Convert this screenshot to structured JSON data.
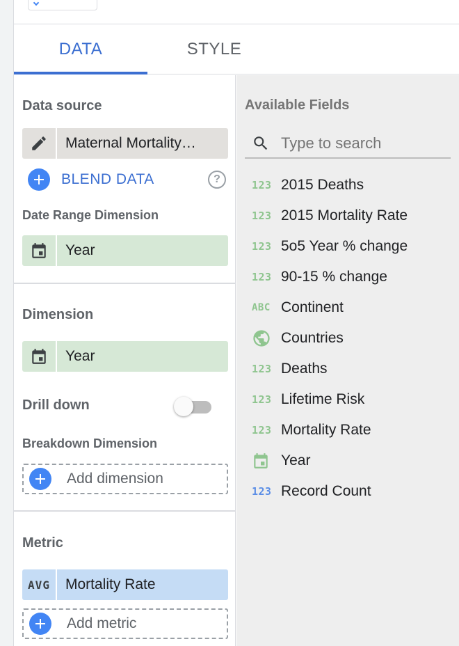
{
  "tabs": {
    "data_label": "DATA",
    "style_label": "STYLE"
  },
  "data_source": {
    "section_label": "Data source",
    "name": "Maternal Mortality…",
    "edit_icon": "pencil-icon",
    "blend_label": "BLEND DATA",
    "help_icon": "help-icon"
  },
  "date_range": {
    "section_label": "Date Range Dimension",
    "field": "Year",
    "icon": "calendar-icon"
  },
  "dimension": {
    "section_label": "Dimension",
    "field": "Year",
    "icon": "calendar-icon",
    "drill_down_label": "Drill down",
    "drill_down_enabled": false,
    "breakdown_label": "Breakdown Dimension",
    "add_dimension_label": "Add dimension"
  },
  "metric": {
    "section_label": "Metric",
    "aggregation": "AVG",
    "field": "Mortality Rate",
    "add_metric_label": "Add metric"
  },
  "available_fields": {
    "title": "Available Fields",
    "search_placeholder": "Type to search",
    "items": [
      {
        "label": "2015 Deaths",
        "type": "number",
        "icon_text": "123"
      },
      {
        "label": "2015 Mortality Rate",
        "type": "number",
        "icon_text": "123"
      },
      {
        "label": "5o5 Year % change",
        "type": "number",
        "icon_text": "123"
      },
      {
        "label": "90-15 % change",
        "type": "number",
        "icon_text": "123"
      },
      {
        "label": "Continent",
        "type": "text",
        "icon_text": "ABC"
      },
      {
        "label": "Countries",
        "type": "geo",
        "icon_text": ""
      },
      {
        "label": "Deaths",
        "type": "number",
        "icon_text": "123"
      },
      {
        "label": "Lifetime Risk",
        "type": "number",
        "icon_text": "123"
      },
      {
        "label": "Mortality Rate",
        "type": "number",
        "icon_text": "123"
      },
      {
        "label": "Year",
        "type": "date",
        "icon_text": ""
      },
      {
        "label": "Record Count",
        "type": "metric",
        "icon_text": "123"
      }
    ]
  },
  "colors": {
    "accent": "#3c6fd1",
    "dimension_green": "#8fc58f",
    "metric_blue": "#5b8ee6"
  }
}
